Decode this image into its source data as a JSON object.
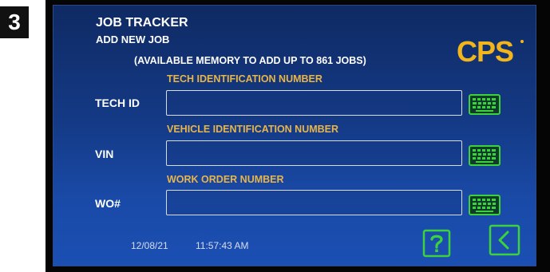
{
  "step_number": "3",
  "header": {
    "title": "JOB TRACKER",
    "subtitle": "ADD NEW JOB",
    "memory_notice": "(AVAILABLE MEMORY TO ADD UP TO 861 JOBS)"
  },
  "brand": {
    "logo_text": "CPS"
  },
  "form": {
    "tech": {
      "section_label": "TECH IDENTIFICATION NUMBER",
      "row_label": "TECH ID",
      "value": "",
      "keyboard_icon": "keyboard-icon"
    },
    "vin": {
      "section_label": "VEHICLE IDENTIFICATION NUMBER",
      "row_label": "VIN",
      "value": "",
      "keyboard_icon": "keyboard-icon"
    },
    "wo": {
      "section_label": "WORK ORDER NUMBER",
      "row_label": "WO#",
      "value": "",
      "keyboard_icon": "keyboard-icon"
    }
  },
  "footer": {
    "date": "12/08/21",
    "time": "11:57:43 AM",
    "help_icon": "help-icon",
    "back_icon": "back-icon"
  },
  "colors": {
    "section_label": "#e8b54a",
    "accent_green": "#3cd23c",
    "logo_yellow": "#f2b51c"
  }
}
